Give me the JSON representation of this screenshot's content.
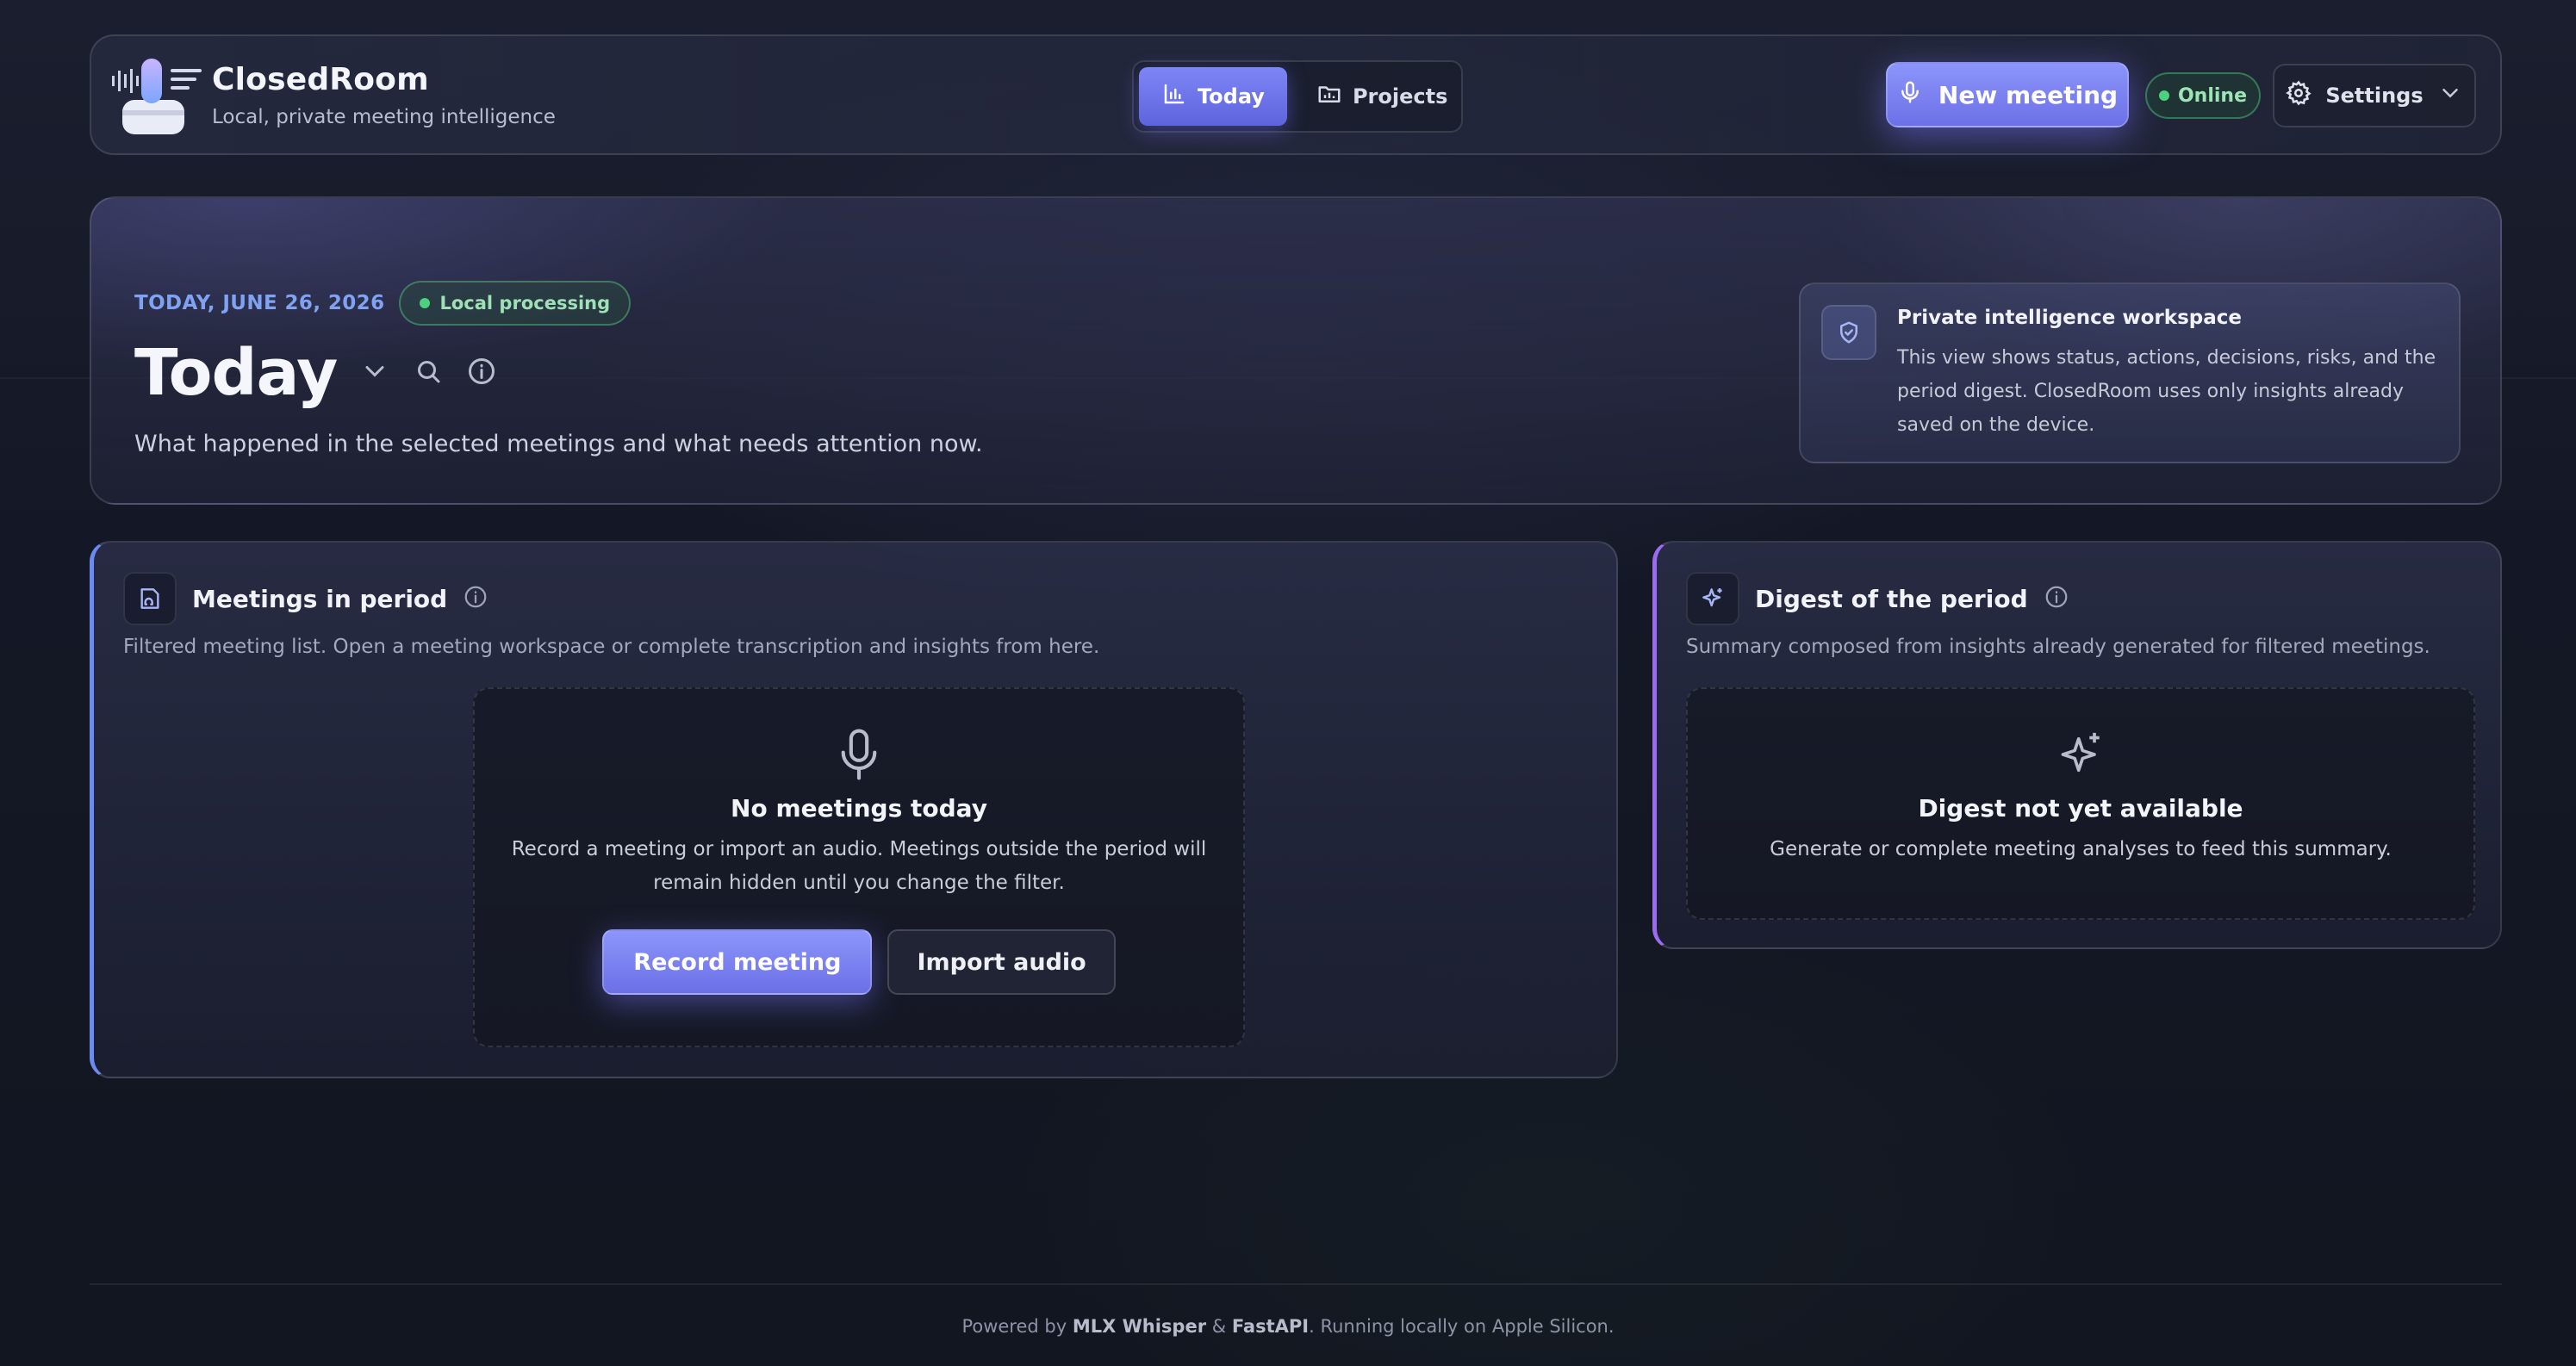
{
  "app": {
    "title": "ClosedRoom",
    "subtitle": "Local, private meeting intelligence"
  },
  "nav": {
    "tabs": [
      {
        "label": "Today",
        "icon": "bar-chart-icon",
        "active": true
      },
      {
        "label": "Projects",
        "icon": "folder-icon",
        "active": false
      }
    ]
  },
  "header": {
    "new_meeting_label": "New meeting",
    "status_label": "Online",
    "settings_label": "Settings"
  },
  "hero": {
    "date": "TODAY, JUNE 26, 2026",
    "badge": "Local processing",
    "title": "Today",
    "description": "What happened in the selected meetings and what needs attention now.",
    "info_title": "Private intelligence workspace",
    "info_body": "This view shows status, actions, decisions, risks, and the period digest. ClosedRoom uses only insights already saved on the device."
  },
  "meetings": {
    "title": "Meetings in period",
    "description": "Filtered meeting list. Open a meeting workspace or complete transcription and insights from here.",
    "empty_title": "No meetings today",
    "empty_body": "Record a meeting or import an audio. Meetings outside the period will remain hidden until you change the filter.",
    "record_label": "Record meeting",
    "import_label": "Import audio"
  },
  "digest": {
    "title": "Digest of the period",
    "description": "Summary composed from insights already generated for filtered meetings.",
    "empty_title": "Digest not yet available",
    "empty_body": "Generate or complete meeting analyses to feed this summary."
  },
  "footer": {
    "prefix": "Powered by ",
    "tech1": "MLX Whisper",
    "amp": " & ",
    "tech2": "FastAPI",
    "suffix": ". Running locally on Apple Silicon."
  },
  "colors": {
    "accent": "#7d86f6",
    "online": "#4cd180",
    "date": "#7fa2f2",
    "meetings_border": "#6b8bf0",
    "digest_border": "#9b6bf0"
  }
}
